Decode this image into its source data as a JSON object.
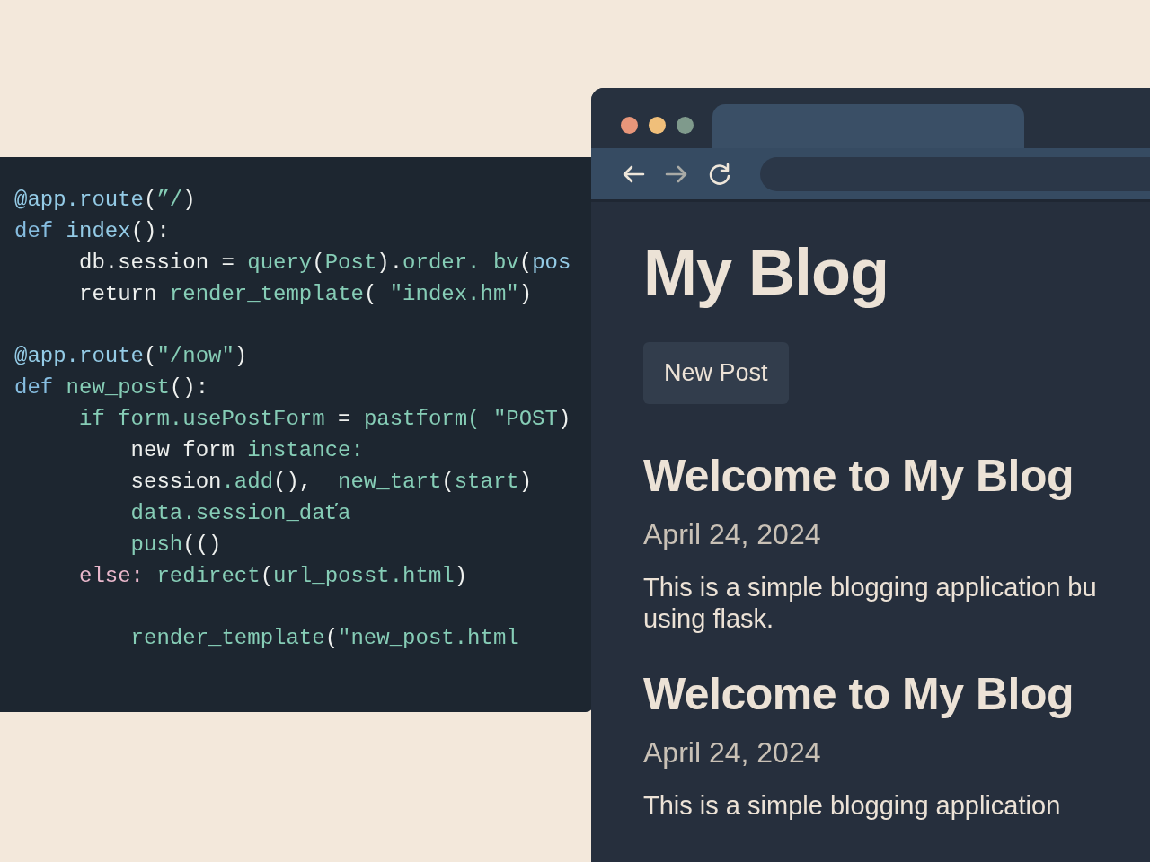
{
  "code_editor": {
    "blocks": [
      [
        [
          {
            "text": "@app.route",
            "kind": "decorator"
          },
          {
            "text": "(",
            "kind": "plain"
          },
          {
            "text": "”/",
            "kind": "string"
          },
          {
            "text": ")",
            "kind": "plain"
          }
        ],
        [
          {
            "text": "def ",
            "kind": "keyword"
          },
          {
            "text": "index",
            "kind": "decorator"
          },
          {
            "text": "():",
            "kind": "plain"
          }
        ],
        [
          {
            "text": "     db.session = ",
            "kind": "plain"
          },
          {
            "text": "query",
            "kind": "string"
          },
          {
            "text": "(",
            "kind": "plain"
          },
          {
            "text": "Post",
            "kind": "string"
          },
          {
            "text": ").",
            "kind": "plain"
          },
          {
            "text": "order.",
            "kind": "string"
          },
          {
            "text": " bv",
            "kind": "string"
          },
          {
            "text": "(",
            "kind": "plain"
          },
          {
            "text": "pos",
            "kind": "decorator"
          }
        ],
        [
          {
            "text": "     return ",
            "kind": "plain"
          },
          {
            "text": "render_template",
            "kind": "string"
          },
          {
            "text": "( ",
            "kind": "plain"
          },
          {
            "text": "\"index.hm\"",
            "kind": "string"
          },
          {
            "text": ")",
            "kind": "plain"
          }
        ]
      ],
      [
        [
          {
            "text": "@app.route",
            "kind": "decorator"
          },
          {
            "text": "(",
            "kind": "plain"
          },
          {
            "text": "\"/now\"",
            "kind": "string"
          },
          {
            "text": ")",
            "kind": "plain"
          }
        ],
        [
          {
            "text": "def ",
            "kind": "keyword"
          },
          {
            "text": "new_post",
            "kind": "string"
          },
          {
            "text": "():",
            "kind": "plain"
          }
        ],
        [
          {
            "text": "     if form.usePostForm",
            "kind": "string"
          },
          {
            "text": " = ",
            "kind": "plain"
          },
          {
            "text": "pastform",
            "kind": "string"
          },
          {
            "text": "( \"POST",
            "kind": "string"
          },
          {
            "text": ")",
            "kind": "plain"
          }
        ],
        [
          {
            "text": "         new form ",
            "kind": "plain"
          },
          {
            "text": "instance:",
            "kind": "string"
          }
        ],
        [
          {
            "text": "         session",
            "kind": "plain"
          },
          {
            "text": ".add",
            "kind": "string"
          },
          {
            "text": "(),  ",
            "kind": "plain"
          },
          {
            "text": "new_tart",
            "kind": "string"
          },
          {
            "text": "(",
            "kind": "plain"
          },
          {
            "text": "start",
            "kind": "string"
          },
          {
            "text": ")",
            "kind": "plain"
          }
        ],
        [
          {
            "text": "         data.session_daťa",
            "kind": "string"
          }
        ],
        [
          {
            "text": "         push",
            "kind": "string"
          },
          {
            "text": "(()",
            "kind": "plain"
          }
        ],
        [
          {
            "text": "     else: ",
            "kind": "keyword_alt"
          },
          {
            "text": "redirect",
            "kind": "string"
          },
          {
            "text": "(",
            "kind": "plain"
          },
          {
            "text": "url_posst.html",
            "kind": "string"
          },
          {
            "text": ")",
            "kind": "plain"
          }
        ]
      ],
      [
        [
          {
            "text": "         render_template",
            "kind": "string"
          },
          {
            "text": "(",
            "kind": "plain"
          },
          {
            "text": "\"new_post.html",
            "kind": "string"
          }
        ]
      ]
    ]
  },
  "browser": {
    "window_buttons": [
      {
        "color": "#e8967a"
      },
      {
        "color": "#f0bf7a"
      },
      {
        "color": "#7f9a8c"
      }
    ],
    "page": {
      "title": "My Blog",
      "button": "New Post",
      "posts": [
        {
          "title": "Welcome to My Blog",
          "date": "April 24, 2024",
          "body": "This is a simple blogging application bu\nusing flask."
        },
        {
          "title": "Welcome to My Blog",
          "date": "April 24, 2024",
          "body": "This is a simple blogging application"
        }
      ]
    }
  }
}
